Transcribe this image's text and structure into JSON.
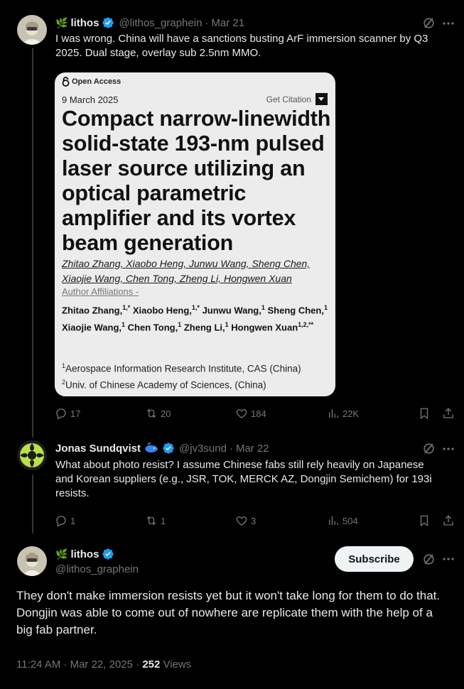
{
  "post1": {
    "display_name": "lithos",
    "leaf_emoji": "🌿",
    "handle": "@lithos_graphein",
    "date": "Mar 21",
    "text": "I was wrong. China will have a sanctions busting ArF immersion scanner by Q3 2025. Dual stage, overlay sub 2.5nm MMO.",
    "card": {
      "open_access": "Open Access",
      "date": "9 March 2025",
      "get_citation": "Get Citation",
      "title": "Compact narrow-linewidth solid-state 193-nm pulsed laser source utilizing an optical parametric amplifier and its vortex beam generation",
      "authors_line1": "Zhitao Zhang, Xiaobo Heng, Junwu Wang, Sheng Chen,",
      "authors_line2": "Xiaojie Wang, Chen Tong, Zheng Li, Hongwen Xuan",
      "author_affiliations": "Author Affiliations -",
      "a1": "Zhitao Zhang,",
      "a1s": "1,*",
      "a2": "Xiaobo Heng,",
      "a2s": "1,*",
      "a3": "Junwu Wang,",
      "a3s": "1",
      "a4": "Sheng Chen,",
      "a4s": "1",
      "a5": "Xiaojie Wang,",
      "a5s": "1",
      "a6": "Chen Tong,",
      "a6s": "1",
      "a7": "Zheng Li,",
      "a7s": "1",
      "a8": "Hongwen Xuan",
      "a8s": "1,2,**",
      "inst1_sup": "1",
      "inst1": "Aerospace Information Research Institute, CAS (China)",
      "inst2_sup": "2",
      "inst2": "Univ. of Chinese Academy of Sciences, (China)"
    },
    "replies": "17",
    "reposts": "20",
    "likes": "184",
    "views": "22K"
  },
  "post2": {
    "display_name": "Jonas Sundqvist",
    "handle": "@jv3sund",
    "date": "Mar 22",
    "text": "What about photo resist? I assume Chinese fabs still rely heavily on Japanese and Korean suppliers (e.g., JSR, TOK, MERCK AZ, Dongjin Semichem) for 193i resists.",
    "replies": "1",
    "reposts": "1",
    "likes": "3",
    "views": "504"
  },
  "post3": {
    "display_name": "lithos",
    "leaf_emoji": "🌿",
    "handle": "@lithos_graphein",
    "subscribe": "Subscribe",
    "text": "They don't make immersion resists yet but it won't take long  for them to do that. Dongjin was able to come out of nowhere are replicate them with the help of a big fab partner.",
    "time": "11:24 AM · Mar 22, 2025 · ",
    "views_count": "252",
    "views_label": " Views"
  },
  "colors": {
    "background": "#000000",
    "text": "#e7e9ea",
    "muted": "#71767b",
    "verified": "#1d9bf0"
  }
}
